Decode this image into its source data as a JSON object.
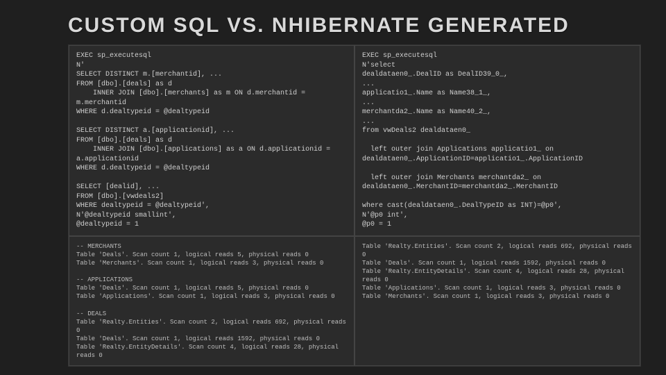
{
  "title": "CUSTOM SQL VS. NHIBERNATE GENERATED",
  "cells": {
    "top_left": "EXEC sp_executesql\nN'\nSELECT DISTINCT m.[merchantid], ...\nFROM [dbo].[deals] as d\n    INNER JOIN [dbo].[merchants] as m ON d.merchantid = m.merchantid\nWHERE d.dealtypeid = @dealtypeid\n\nSELECT DISTINCT a.[applicationid], ...\nFROM [dbo].[deals] as d\n    INNER JOIN [dbo].[applications] as a ON d.applicationid = a.applicationid\nWHERE d.dealtypeid = @dealtypeid\n\nSELECT [dealid], ...\nFROM [dbo].[vwdeals2]\nWHERE dealtypeid = @dealtypeid',\nN'@dealtypeid smallint',\n@dealtypeid = 1",
    "top_right": "EXEC sp_executesql\nN'select\ndealdataen0_.DealID as DealID39_0_,\n...\napplicatio1_.Name as Name38_1_,\n...\nmerchantda2_.Name as Name40_2_,\n...\nfrom vwDeals2 dealdataen0_\n\n  left outer join Applications applicatio1_ on dealdataen0_.ApplicationID=applicatio1_.ApplicationID\n\n  left outer join Merchants merchantda2_ on dealdataen0_.MerchantID=merchantda2_.MerchantID\n\nwhere cast(dealdataen0_.DealTypeID as INT)=@p0',\nN'@p0 int',\n@p0 = 1",
    "bottom_left": "-- MERCHANTS\nTable 'Deals'. Scan count 1, logical reads 5, physical reads 0\nTable 'Merchants'. Scan count 1, logical reads 3, physical reads 0\n\n-- APPLICATIONS\nTable 'Deals'. Scan count 1, logical reads 5, physical reads 0\nTable 'Applications'. Scan count 1, logical reads 3, physical reads 0\n\n-- DEALS\nTable 'Realty.Entities'. Scan count 2, logical reads 692, physical reads 0\nTable 'Deals'. Scan count 1, logical reads 1592, physical reads 0\nTable 'Realty.EntityDetails'. Scan count 4, logical reads 28, physical reads 0",
    "bottom_right": "Table 'Realty.Entities'. Scan count 2, logical reads 692, physical reads 0\nTable 'Deals'. Scan count 1, logical reads 1592, physical reads 0\nTable 'Realty.EntityDetails'. Scan count 4, logical reads 28, physical reads 0\nTable 'Applications'. Scan count 1, logical reads 3, physical reads 0\nTable 'Merchants'. Scan count 1, logical reads 3, physical reads 0"
  }
}
